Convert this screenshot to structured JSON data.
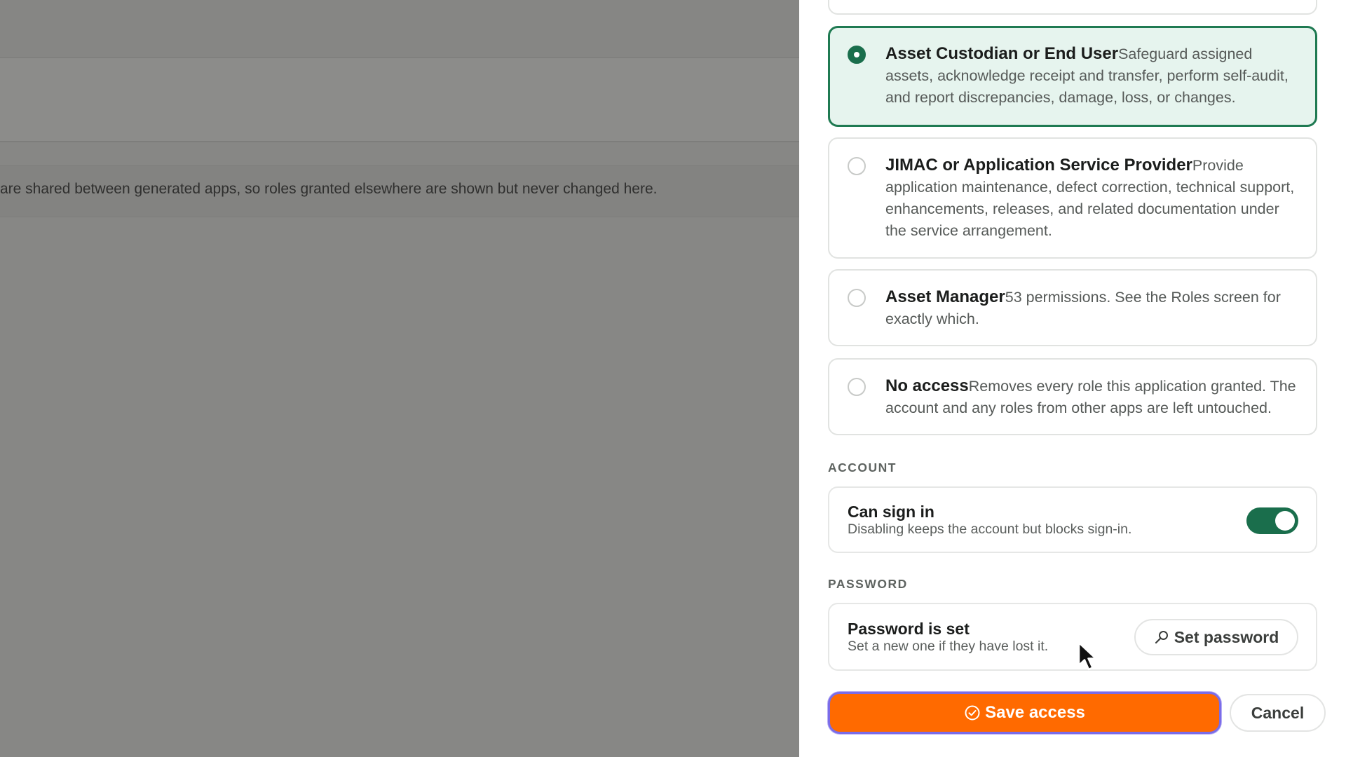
{
  "background": {
    "notice_text": "are shared between generated apps, so roles granted elsewhere are shown but never changed here."
  },
  "roles": [
    {
      "name": "Asset Custodian or End User",
      "description": "Safeguard assigned assets, acknowledge receipt and transfer, perform self-audit, and report discrepancies, damage, loss, or changes.",
      "selected": true
    },
    {
      "name": "JIMAC or Application Service Provider",
      "description": "Provide application maintenance, defect correction, technical support, enhancements, releases, and related documentation under the service arrangement.",
      "selected": false
    },
    {
      "name": "Asset Manager",
      "description": "53 permissions. See the Roles screen for exactly which.",
      "selected": false
    },
    {
      "name": "No access",
      "description": "Removes every role this application granted. The account and any roles from other apps are left untouched.",
      "selected": false
    }
  ],
  "account": {
    "section_label": "ACCOUNT",
    "title": "Can sign in",
    "description": "Disabling keeps the account but blocks sign-in.",
    "toggle_on": true
  },
  "password": {
    "section_label": "PASSWORD",
    "title": "Password is set",
    "description": "Set a new one if they have lost it.",
    "button_label": "Set password",
    "button_icon": "search-key-icon"
  },
  "actions": {
    "save_label": "Save access",
    "save_icon": "check-circle-icon",
    "cancel_label": "Cancel"
  },
  "colors": {
    "accent_green": "#1a6e4c",
    "selected_bg": "#e6f4ee",
    "save_orange": "#ff6a00",
    "focus_ring": "#7a6ce8"
  }
}
